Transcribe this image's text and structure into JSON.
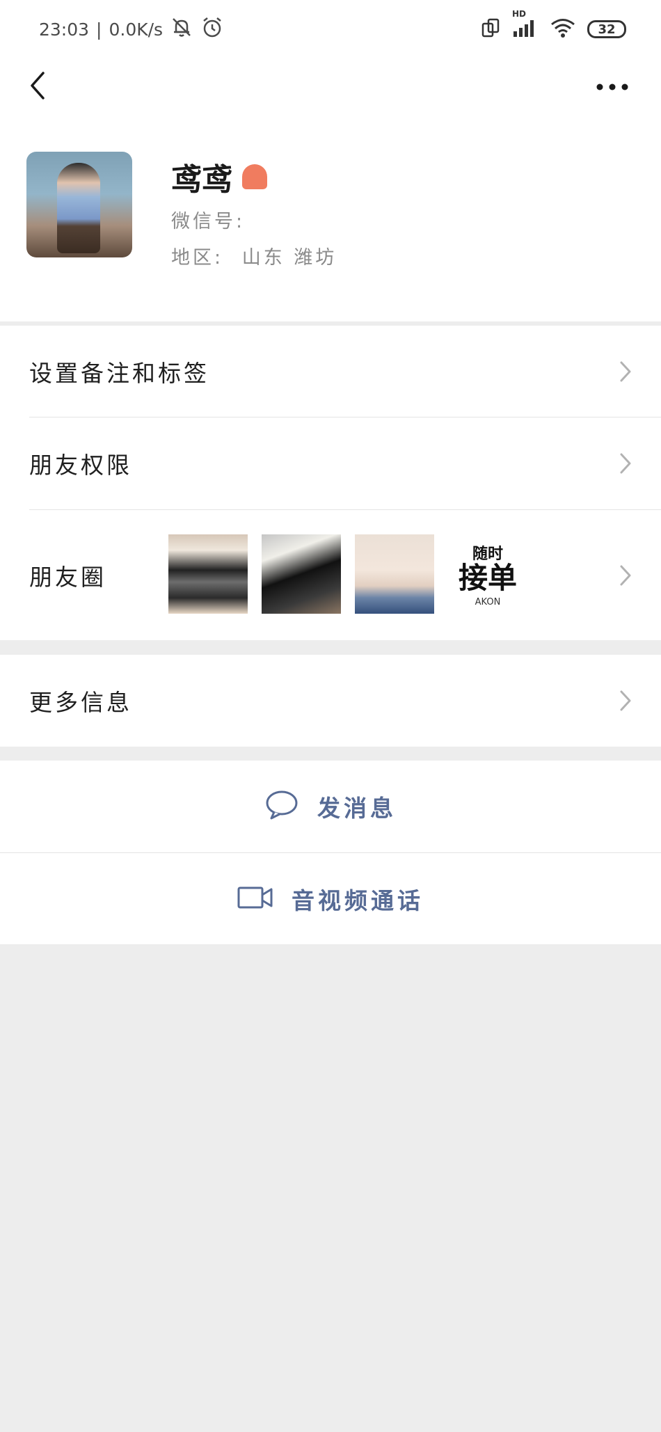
{
  "status_bar": {
    "time": "23:03",
    "separator": "|",
    "net_speed": "0.0K/s",
    "hd_label": "HD",
    "battery": "32"
  },
  "profile": {
    "name": "鸢鸢",
    "wechat_id_label": "微信号:",
    "region_label": "地区:",
    "region_value": "山东  潍坊"
  },
  "menu": {
    "remark_tags": "设置备注和标签",
    "friend_permissions": "朋友权限",
    "moments": "朋友圈",
    "more_info": "更多信息"
  },
  "moments_thumb": {
    "top_text": "随时",
    "main_text": "接单",
    "tag": "AKON"
  },
  "actions": {
    "send_message": "发消息",
    "video_call": "音视频通话"
  },
  "colors": {
    "link_blue": "#576b95",
    "page_bg": "#ededed",
    "gender_badge": "#f07c5f"
  }
}
